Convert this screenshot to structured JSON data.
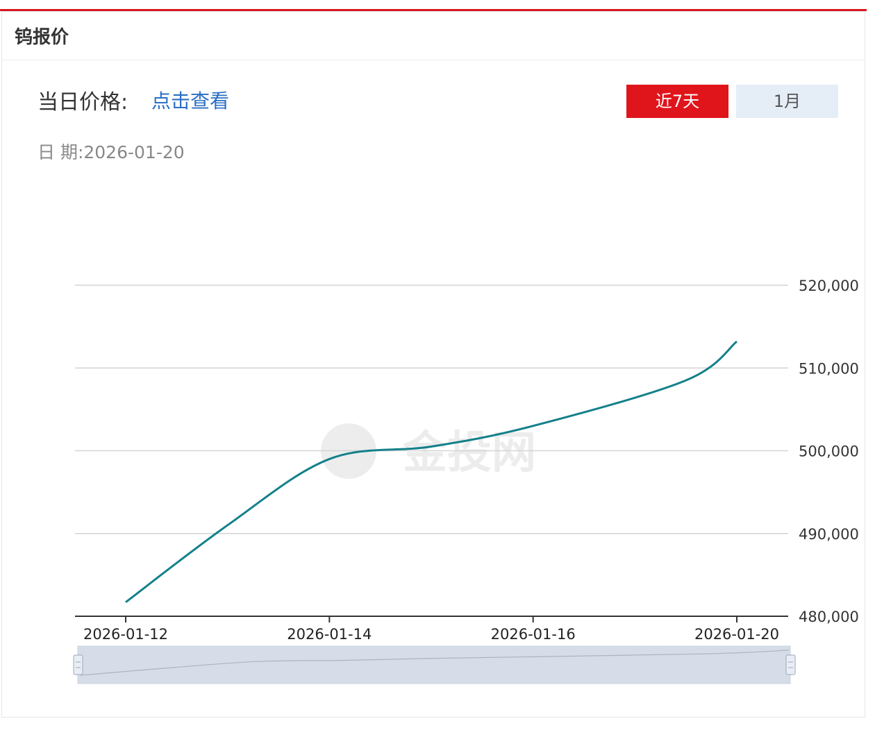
{
  "header": {
    "title": "钨报价"
  },
  "price": {
    "label": "当日价格:",
    "link": "点击查看"
  },
  "date": {
    "label": "日 期:",
    "value": "2026-01-20"
  },
  "tabs": [
    {
      "label": "近7天",
      "active": true
    },
    {
      "label": "1月",
      "active": false
    }
  ],
  "watermark": {
    "text": "金投网"
  },
  "colors": {
    "accent": "#d9161c",
    "line": "#13808a",
    "link": "#2a6fc4",
    "inactive_tab": "#e5edf6"
  },
  "chart_data": {
    "type": "line",
    "x": [
      "2026-01-12",
      "2026-01-13",
      "2026-01-14",
      "2026-01-15",
      "2026-01-16",
      "2026-01-19",
      "2026-01-20"
    ],
    "x_ticks": [
      "2026-01-12",
      "2026-01-14",
      "2026-01-16",
      "2026-01-20"
    ],
    "y": [
      481700,
      491000,
      499000,
      500500,
      503000,
      508500,
      513200
    ],
    "ylim": [
      480000,
      520000
    ],
    "y_ticks": [
      480000,
      490000,
      500000,
      510000,
      520000
    ],
    "y_tick_labels": [
      "480,000",
      "490,000",
      "500,000",
      "510,000",
      "520,000"
    ],
    "grid": true,
    "y_axis_side": "right",
    "data_zoom": true
  }
}
